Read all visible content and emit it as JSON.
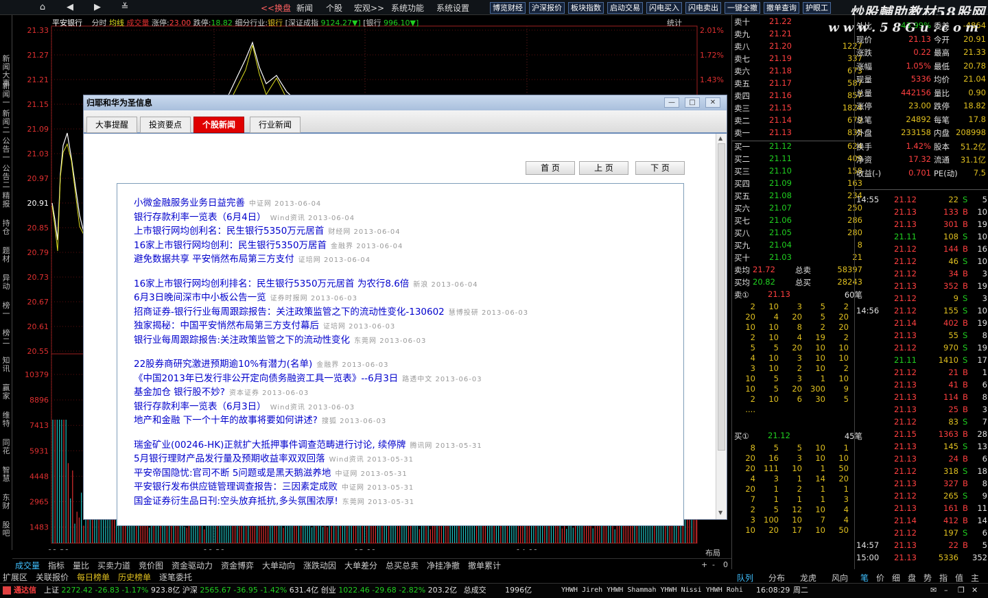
{
  "topbar": {
    "menu": [
      "<<换盘",
      "新闻",
      "个股",
      "宏观>>",
      "系统功能",
      "系统设置"
    ],
    "buttons": [
      "博览财经",
      "沪深报价",
      "板块指数",
      "启动交易",
      "闪电买入",
      "闪电卖出",
      "一键全撤",
      "撤单查询",
      "护眼工"
    ],
    "watermark1": "炒股輔助教材58股网",
    "watermark2": "www.58Gu.com"
  },
  "left_tabs": [
    "新闻大事",
    "新闻一",
    "新闻二",
    "公告一",
    "公告二",
    "精报",
    "持仓",
    "题材",
    "异动",
    "榜一",
    "榜二",
    "知讯",
    "赢家",
    "维特",
    "同花",
    "智慧",
    "东财",
    "股吧"
  ],
  "stock_info": {
    "name": "平安银行",
    "mode1": "分时",
    "mode2": "均线",
    "vol": "成交量",
    "up_label": "涨停:",
    "up": "23.00",
    "down_label": "跌停:",
    "down": "18.82",
    "industry_label": "细分行业:",
    "industry": "银行",
    "idx_label": "[深证成指",
    "idx_val": "9124.27▼]",
    "bank_label": "[银行",
    "bank_val": "996.10▼]",
    "stat": "统计"
  },
  "chart_data": {
    "type": "line",
    "price_ticks": [
      "21.33",
      "21.27",
      "21.21",
      "21.15",
      "21.09",
      "21.03",
      "20.97",
      "20.91",
      "20.85",
      "20.79",
      "20.73",
      "20.67",
      "20.61",
      "20.55"
    ],
    "pct_ticks": [
      "2.01%",
      "1.72%",
      "1.43%"
    ],
    "vol_ticks": [
      "10379",
      "8896",
      "7413",
      "5931",
      "4448",
      "2965",
      "1483"
    ],
    "time_ticks": [
      "09:30",
      "10:30",
      "13:00",
      "14:00"
    ],
    "price_series": [
      20.91,
      20.87,
      20.82,
      20.98,
      21.05,
      21.08,
      21.02,
      20.95,
      20.88,
      20.84,
      20.86,
      20.9,
      20.95,
      21.05,
      21.26,
      21.3,
      21.24,
      21.2,
      21.22,
      21.18,
      21.15,
      21.14,
      21.16,
      21.13
    ]
  },
  "right_panel": {
    "sell": [
      [
        "卖十",
        "21.22",
        "",
        ""
      ],
      [
        "卖九",
        "21.21",
        "",
        ""
      ],
      [
        "卖八",
        "21.20",
        "1227",
        ""
      ],
      [
        "卖七",
        "21.19",
        "337",
        ""
      ],
      [
        "卖六",
        "21.18",
        "673",
        ""
      ],
      [
        "卖五",
        "21.17",
        "587",
        ""
      ],
      [
        "卖四",
        "21.16",
        "857",
        ""
      ],
      [
        "卖三",
        "21.15",
        "1824",
        ""
      ],
      [
        "卖二",
        "21.14",
        "679",
        ""
      ],
      [
        "卖一",
        "21.13",
        "835",
        ""
      ]
    ],
    "buy": [
      [
        "买一",
        "21.12",
        "624"
      ],
      [
        "买二",
        "21.11",
        "409"
      ],
      [
        "买三",
        "21.10",
        "158"
      ],
      [
        "买四",
        "21.09",
        "163"
      ],
      [
        "买五",
        "21.08",
        "234"
      ],
      [
        "买六",
        "21.07",
        "250"
      ],
      [
        "买七",
        "21.06",
        "286"
      ],
      [
        "买八",
        "21.05",
        "280"
      ],
      [
        "买九",
        "21.04",
        "8"
      ],
      [
        "买十",
        "21.03",
        "21"
      ]
    ],
    "avg": [
      [
        "卖均",
        "21.72",
        "总卖",
        "58397"
      ],
      [
        "买均",
        "20.82",
        "总买",
        "28243"
      ]
    ],
    "q1": [
      "卖①",
      "21.13",
      "60笔"
    ],
    "q2": [
      "买①",
      "21.12",
      "45笔"
    ],
    "q1_rows": [
      [
        "2",
        "10",
        "3",
        "5",
        "2"
      ],
      [
        "20",
        "4",
        "20",
        "5",
        "20"
      ],
      [
        "10",
        "10",
        "8",
        "2",
        "20"
      ],
      [
        "2",
        "10",
        "4",
        "19",
        "2"
      ],
      [
        "5",
        "5",
        "20",
        "10",
        "10"
      ],
      [
        "4",
        "10",
        "3",
        "10",
        "10"
      ],
      [
        "3",
        "10",
        "2",
        "10",
        "2"
      ],
      [
        "10",
        "5",
        "3",
        "1",
        "10"
      ],
      [
        "10",
        "5",
        "20",
        "300",
        "9"
      ],
      [
        "2",
        "10",
        "6",
        "30",
        "5"
      ],
      [
        "....",
        "",
        "",
        "",
        ""
      ]
    ],
    "q2_rows": [
      [
        "8",
        "5",
        "5",
        "10",
        "1"
      ],
      [
        "20",
        "16",
        "3",
        "10",
        "10"
      ],
      [
        "20",
        "111",
        "10",
        "1",
        "50"
      ],
      [
        "4",
        "3",
        "1",
        "14",
        "20"
      ],
      [
        "20",
        "1",
        "2",
        "1",
        "1"
      ],
      [
        "7",
        "1",
        "1",
        "1",
        "3"
      ],
      [
        "2",
        "5",
        "12",
        "10",
        "4"
      ],
      [
        "3",
        "100",
        "10",
        "7",
        "4"
      ],
      [
        "10",
        "20",
        "17",
        "10",
        "50"
      ]
    ],
    "stats": [
      [
        "外比",
        "-43.99%",
        "委差",
        "-4864"
      ],
      [
        "现价",
        "21.13",
        "今开",
        "20.91"
      ],
      [
        "涨跌",
        "0.22",
        "最高",
        "21.33"
      ],
      [
        "涨幅",
        "1.05%",
        "最低",
        "20.78"
      ],
      [
        "现量",
        "5336",
        "均价",
        "21.04"
      ],
      [
        "总量",
        "442156",
        "量比",
        "0.90"
      ],
      [
        "涨停",
        "23.00",
        "跌停",
        "18.82"
      ],
      [
        "总笔",
        "24892",
        "每笔",
        "17.8"
      ],
      [
        "外盘",
        "233158",
        "内盘",
        "208998"
      ],
      [
        "换手",
        "1.42%",
        "股本",
        "51.2亿"
      ],
      [
        "净资",
        "17.32",
        "流通",
        "31.1亿"
      ],
      [
        "收益(-)",
        "0.701",
        "PE(动)",
        "7.5"
      ]
    ],
    "ticks": [
      [
        "14:55",
        "21.12",
        "22",
        "S",
        "5"
      ],
      [
        "",
        "21.13",
        "133",
        "B",
        "10"
      ],
      [
        "",
        "21.13",
        "301",
        "B",
        "19"
      ],
      [
        "",
        "21.11",
        "108",
        "S",
        "10"
      ],
      [
        "",
        "21.12",
        "144",
        "B",
        "16"
      ],
      [
        "",
        "21.12",
        "46",
        "S",
        "10"
      ],
      [
        "",
        "21.12",
        "34",
        "B",
        "3"
      ],
      [
        "",
        "21.13",
        "352",
        "B",
        "19"
      ],
      [
        "",
        "21.12",
        "9",
        "S",
        "3"
      ],
      [
        "14:56",
        "21.12",
        "155",
        "S",
        "10"
      ],
      [
        "",
        "21.14",
        "402",
        "B",
        "19"
      ],
      [
        "",
        "21.13",
        "55",
        "S",
        "8"
      ],
      [
        "",
        "21.12",
        "970",
        "S",
        "19"
      ],
      [
        "",
        "21.11",
        "1410",
        "S",
        "17"
      ],
      [
        "",
        "21.12",
        "21",
        "B",
        "1"
      ],
      [
        "",
        "21.13",
        "41",
        "B",
        "6"
      ],
      [
        "",
        "21.13",
        "114",
        "B",
        "8"
      ],
      [
        "",
        "21.13",
        "25",
        "B",
        "3"
      ],
      [
        "",
        "21.12",
        "83",
        "S",
        "7"
      ],
      [
        "",
        "21.15",
        "1363",
        "B",
        "28"
      ],
      [
        "",
        "21.13",
        "145",
        "S",
        "13"
      ],
      [
        "",
        "21.13",
        "24",
        "B",
        "6"
      ],
      [
        "",
        "21.12",
        "318",
        "S",
        "18"
      ],
      [
        "",
        "21.13",
        "327",
        "B",
        "8"
      ],
      [
        "",
        "21.12",
        "265",
        "S",
        "9"
      ],
      [
        "",
        "21.13",
        "161",
        "B",
        "11"
      ],
      [
        "",
        "21.14",
        "412",
        "B",
        "14"
      ],
      [
        "",
        "21.12",
        "197",
        "S",
        "6"
      ],
      [
        "14:57",
        "21.13",
        "22",
        "B",
        "5"
      ],
      [
        "15:00",
        "21.13",
        "5336",
        "",
        "352"
      ]
    ],
    "rtabs": [
      "队列",
      "分布",
      "龙虎",
      "风向"
    ],
    "rtabs2": [
      "笔",
      "价",
      "细",
      "盘",
      "势",
      "指",
      "值",
      "主"
    ]
  },
  "bottom_tabs": [
    "成交量",
    "指标",
    "量比",
    "买卖力道",
    "竞价图",
    "资金驱动力",
    "资金博弈",
    "大单动向",
    "涨跌动因",
    "大单差分",
    "总买总卖",
    "净挂净撤",
    "撤单累计"
  ],
  "bottom_right": "布局",
  "bottom_tabs2": [
    "扩展区",
    "关联报价",
    "每日榜单",
    "历史榜单",
    "逐笔委托"
  ],
  "status": {
    "app": "通达信",
    "sh": "上证",
    "sh_v": "2272.42",
    "sh_c": "-26.83",
    "sh_p": "-1.17%",
    "sh_a": "923.8亿",
    "hs": "沪深",
    "hs_v": "2565.67",
    "hs_c": "-36.95",
    "hs_p": "-1.42%",
    "hs_a": "631.4亿",
    "cy": "创业",
    "cy_v": "1022.46",
    "cy_c": "-29.68",
    "cy_p": "-2.82%",
    "cy_a": "203.2亿",
    "total": "总成交",
    "total_v": "1996亿",
    "scroll": "YHWH Jireh YHWH Shammah YHWH Nissi YHWH Rohi",
    "time": "16:08:29",
    "week": "周二"
  },
  "dialog": {
    "title": "归耶和华为圣信息",
    "tabs": [
      "大事提醒",
      "投资要点",
      "个股新闻",
      "行业新闻"
    ],
    "page_buttons": [
      "首 页",
      "上 页",
      "下 页"
    ],
    "news": [
      [
        [
          "小微金融服务业务日益完善",
          "中证网 2013-06-04"
        ],
        [
          "银行存款利率一览表（6月4日）",
          "Wind资讯 2013-06-04"
        ],
        [
          "上市银行网均创利名：民生银行5350万元居首",
          "财经网 2013-06-04"
        ],
        [
          "16家上市银行网均创利：民生银行5350万居首",
          "金融界 2013-06-04"
        ],
        [
          "避免数据共享 平安悄然布局第三方支付",
          "证培网 2013-06-04"
        ]
      ],
      [
        [
          "16家上市银行网均创利排名：民生银行5350万元居首 为农行8.6倍",
          "新浪 2013-06-04"
        ],
        [
          "6月3日晚间深市中小板公告一览",
          "证券时报网 2013-06-03"
        ],
        [
          "招商证券-银行行业每周跟踪报告：关注政策监管之下的流动性变化-130602",
          "慧博投研 2013-06-03"
        ],
        [
          "独家揭秘：中国平安悄然布局第三方支付幕后",
          "证培网 2013-06-03"
        ],
        [
          "银行业每周跟踪报告:关注政策监管之下的流动性变化",
          "东莞网 2013-06-03"
        ]
      ],
      [
        [
          "22股券商研究激进预期逾10%有潜力(名单)",
          "金融界 2013-06-03"
        ],
        [
          "《中国2013年已发行非公开定向债务融资工具一览表》--6月3日",
          "路透中文 2013-06-03"
        ],
        [
          "基金加仓 银行股不妙?",
          "资本证券 2013-06-03"
        ],
        [
          "银行存款利率一览表（6月3日）",
          "Wind资讯 2013-06-03"
        ],
        [
          "地产和金融 下一个十年的故事将要如何讲述?",
          "搜狐 2013-06-03"
        ]
      ],
      [
        [
          "瑞金矿业(00246-HK)正就扩大抵押事件调查范畴进行讨论, 续停牌",
          "腾讯网 2013-05-31"
        ],
        [
          "5月银行理财产品发行量及预期收益率双双回落",
          "Wind资讯 2013-05-31"
        ],
        [
          "平安帝国隐忧:官司不断 5问题或是黑天鹅滋养地",
          "中证网 2013-05-31"
        ],
        [
          "平安银行发布供应链管理调查报告：三因素定成败",
          "中证网 2013-05-31"
        ],
        [
          "国金证券衍生品日刊:空头放弃抵抗,多头氛围浓厚!",
          "东莞网 2013-05-31"
        ]
      ]
    ]
  }
}
